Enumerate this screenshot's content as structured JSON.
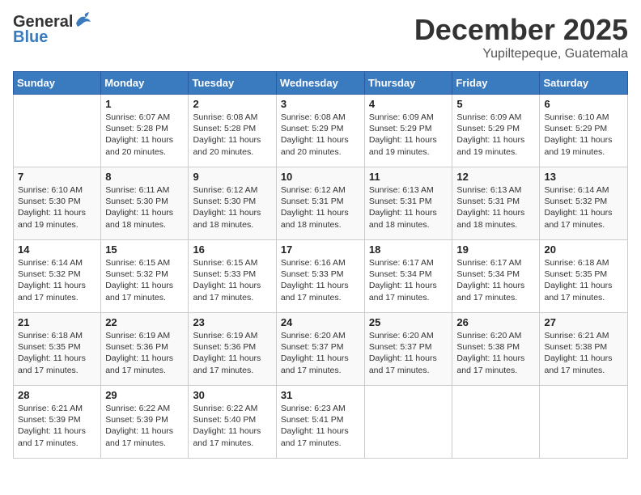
{
  "header": {
    "logo_general": "General",
    "logo_blue": "Blue",
    "month": "December 2025",
    "location": "Yupiltepeque, Guatemala"
  },
  "calendar": {
    "weekdays": [
      "Sunday",
      "Monday",
      "Tuesday",
      "Wednesday",
      "Thursday",
      "Friday",
      "Saturday"
    ],
    "weeks": [
      [
        {
          "day": "",
          "info": ""
        },
        {
          "day": "1",
          "info": "Sunrise: 6:07 AM\nSunset: 5:28 PM\nDaylight: 11 hours\nand 20 minutes."
        },
        {
          "day": "2",
          "info": "Sunrise: 6:08 AM\nSunset: 5:28 PM\nDaylight: 11 hours\nand 20 minutes."
        },
        {
          "day": "3",
          "info": "Sunrise: 6:08 AM\nSunset: 5:29 PM\nDaylight: 11 hours\nand 20 minutes."
        },
        {
          "day": "4",
          "info": "Sunrise: 6:09 AM\nSunset: 5:29 PM\nDaylight: 11 hours\nand 19 minutes."
        },
        {
          "day": "5",
          "info": "Sunrise: 6:09 AM\nSunset: 5:29 PM\nDaylight: 11 hours\nand 19 minutes."
        },
        {
          "day": "6",
          "info": "Sunrise: 6:10 AM\nSunset: 5:29 PM\nDaylight: 11 hours\nand 19 minutes."
        }
      ],
      [
        {
          "day": "7",
          "info": "Sunrise: 6:10 AM\nSunset: 5:30 PM\nDaylight: 11 hours\nand 19 minutes."
        },
        {
          "day": "8",
          "info": "Sunrise: 6:11 AM\nSunset: 5:30 PM\nDaylight: 11 hours\nand 18 minutes."
        },
        {
          "day": "9",
          "info": "Sunrise: 6:12 AM\nSunset: 5:30 PM\nDaylight: 11 hours\nand 18 minutes."
        },
        {
          "day": "10",
          "info": "Sunrise: 6:12 AM\nSunset: 5:31 PM\nDaylight: 11 hours\nand 18 minutes."
        },
        {
          "day": "11",
          "info": "Sunrise: 6:13 AM\nSunset: 5:31 PM\nDaylight: 11 hours\nand 18 minutes."
        },
        {
          "day": "12",
          "info": "Sunrise: 6:13 AM\nSunset: 5:31 PM\nDaylight: 11 hours\nand 18 minutes."
        },
        {
          "day": "13",
          "info": "Sunrise: 6:14 AM\nSunset: 5:32 PM\nDaylight: 11 hours\nand 17 minutes."
        }
      ],
      [
        {
          "day": "14",
          "info": "Sunrise: 6:14 AM\nSunset: 5:32 PM\nDaylight: 11 hours\nand 17 minutes."
        },
        {
          "day": "15",
          "info": "Sunrise: 6:15 AM\nSunset: 5:32 PM\nDaylight: 11 hours\nand 17 minutes."
        },
        {
          "day": "16",
          "info": "Sunrise: 6:15 AM\nSunset: 5:33 PM\nDaylight: 11 hours\nand 17 minutes."
        },
        {
          "day": "17",
          "info": "Sunrise: 6:16 AM\nSunset: 5:33 PM\nDaylight: 11 hours\nand 17 minutes."
        },
        {
          "day": "18",
          "info": "Sunrise: 6:17 AM\nSunset: 5:34 PM\nDaylight: 11 hours\nand 17 minutes."
        },
        {
          "day": "19",
          "info": "Sunrise: 6:17 AM\nSunset: 5:34 PM\nDaylight: 11 hours\nand 17 minutes."
        },
        {
          "day": "20",
          "info": "Sunrise: 6:18 AM\nSunset: 5:35 PM\nDaylight: 11 hours\nand 17 minutes."
        }
      ],
      [
        {
          "day": "21",
          "info": "Sunrise: 6:18 AM\nSunset: 5:35 PM\nDaylight: 11 hours\nand 17 minutes."
        },
        {
          "day": "22",
          "info": "Sunrise: 6:19 AM\nSunset: 5:36 PM\nDaylight: 11 hours\nand 17 minutes."
        },
        {
          "day": "23",
          "info": "Sunrise: 6:19 AM\nSunset: 5:36 PM\nDaylight: 11 hours\nand 17 minutes."
        },
        {
          "day": "24",
          "info": "Sunrise: 6:20 AM\nSunset: 5:37 PM\nDaylight: 11 hours\nand 17 minutes."
        },
        {
          "day": "25",
          "info": "Sunrise: 6:20 AM\nSunset: 5:37 PM\nDaylight: 11 hours\nand 17 minutes."
        },
        {
          "day": "26",
          "info": "Sunrise: 6:20 AM\nSunset: 5:38 PM\nDaylight: 11 hours\nand 17 minutes."
        },
        {
          "day": "27",
          "info": "Sunrise: 6:21 AM\nSunset: 5:38 PM\nDaylight: 11 hours\nand 17 minutes."
        }
      ],
      [
        {
          "day": "28",
          "info": "Sunrise: 6:21 AM\nSunset: 5:39 PM\nDaylight: 11 hours\nand 17 minutes."
        },
        {
          "day": "29",
          "info": "Sunrise: 6:22 AM\nSunset: 5:39 PM\nDaylight: 11 hours\nand 17 minutes."
        },
        {
          "day": "30",
          "info": "Sunrise: 6:22 AM\nSunset: 5:40 PM\nDaylight: 11 hours\nand 17 minutes."
        },
        {
          "day": "31",
          "info": "Sunrise: 6:23 AM\nSunset: 5:41 PM\nDaylight: 11 hours\nand 17 minutes."
        },
        {
          "day": "",
          "info": ""
        },
        {
          "day": "",
          "info": ""
        },
        {
          "day": "",
          "info": ""
        }
      ]
    ]
  }
}
